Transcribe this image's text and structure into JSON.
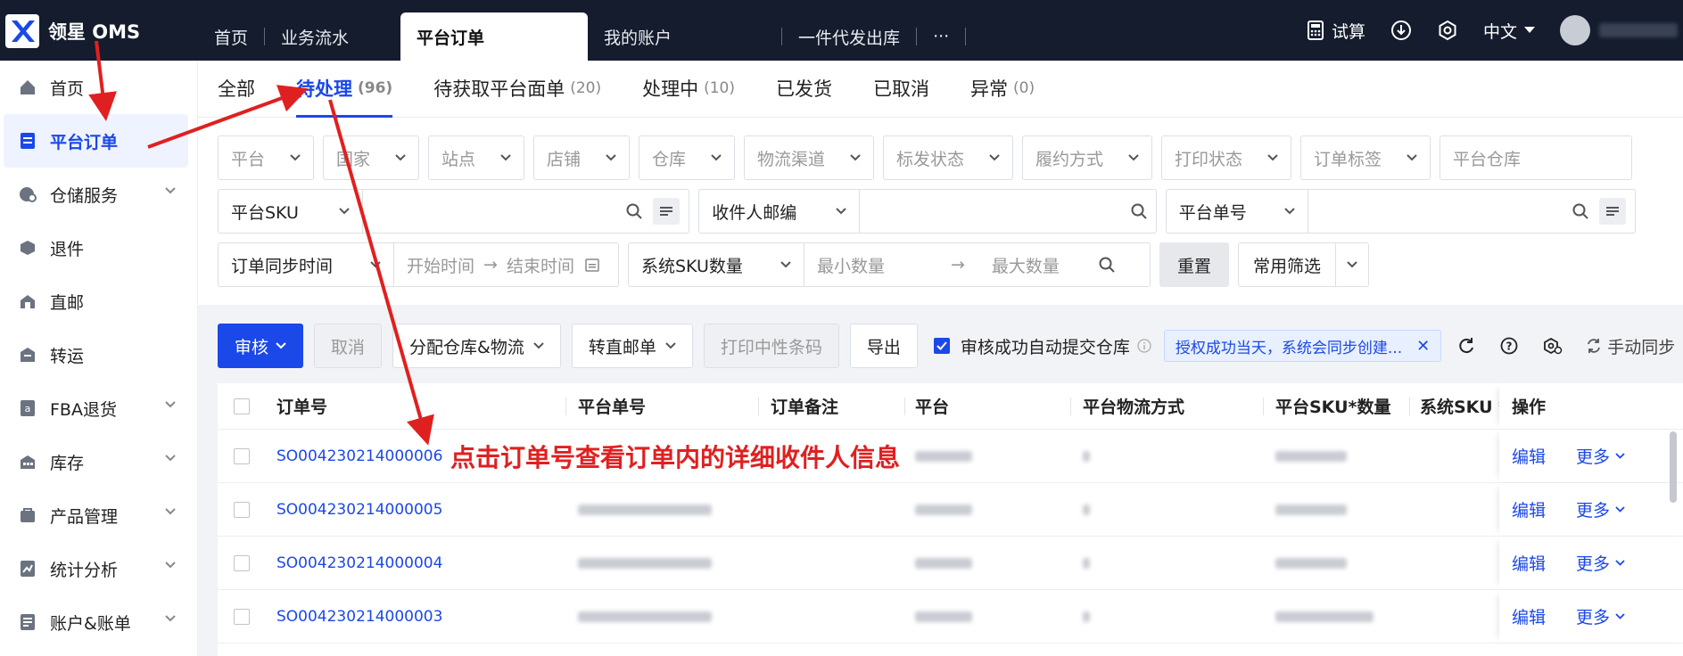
{
  "app": {
    "name": "领星 OMS"
  },
  "topbar": {
    "tabs": [
      "首页",
      "业务流水",
      "平台订单",
      "我的账户",
      "一件代发出库",
      "···"
    ],
    "active_tab_index": 2,
    "right": {
      "calc": "试算",
      "lang": "中文"
    }
  },
  "sidebar": {
    "items": [
      {
        "label": "首页",
        "icon": "home-icon",
        "chevron": false
      },
      {
        "label": "平台订单",
        "icon": "order-icon",
        "chevron": false,
        "active": true
      },
      {
        "label": "仓储服务",
        "icon": "warehouse-icon",
        "chevron": true
      },
      {
        "label": "退件",
        "icon": "return-icon",
        "chevron": false
      },
      {
        "label": "直邮",
        "icon": "direct-mail-icon",
        "chevron": false
      },
      {
        "label": "转运",
        "icon": "transfer-icon",
        "chevron": false
      },
      {
        "label": "FBA退货",
        "icon": "fba-icon",
        "chevron": true
      },
      {
        "label": "库存",
        "icon": "inventory-icon",
        "chevron": true
      },
      {
        "label": "产品管理",
        "icon": "product-icon",
        "chevron": true
      },
      {
        "label": "统计分析",
        "icon": "chart-icon",
        "chevron": true
      },
      {
        "label": "账户&账单",
        "icon": "account-icon",
        "chevron": true
      }
    ]
  },
  "subtabs": [
    {
      "label": "全部",
      "count": ""
    },
    {
      "label": "待处理",
      "count": "(96)",
      "active": true
    },
    {
      "label": "待获取平台面单",
      "count": "(20)"
    },
    {
      "label": "处理中",
      "count": "(10)"
    },
    {
      "label": "已发货",
      "count": ""
    },
    {
      "label": "已取消",
      "count": ""
    },
    {
      "label": "异常",
      "count": "(0)"
    }
  ],
  "filters": {
    "row1": [
      "平台",
      "国家",
      "站点",
      "店铺",
      "仓库",
      "物流渠道",
      "标发状态",
      "履约方式",
      "打印状态",
      "订单标签"
    ],
    "row1_input": "平台仓库",
    "sku_select": "平台SKU",
    "zip_select": "收件人邮编",
    "platform_no_select": "平台单号",
    "sync_time_select": "订单同步时间",
    "start_time": "开始时间",
    "end_time": "结束时间",
    "sku_qty_select": "系统SKU数量",
    "min_qty": "最小数量",
    "max_qty": "最大数量",
    "reset": "重置",
    "common_filter": "常用筛选"
  },
  "actions": {
    "review": "审核",
    "cancel": "取消",
    "assign": "分配仓库&物流",
    "to_direct": "转直邮单",
    "print_neutral": "打印中性条码",
    "export": "导出",
    "auto_submit": "审核成功自动提交仓库",
    "notice": "授权成功当天，系统会同步创建...",
    "manual_sync": "手动同步"
  },
  "table": {
    "headers": [
      "订单号",
      "平台单号",
      "订单备注",
      "平台",
      "平台物流方式",
      "平台SKU*数量",
      "系统SKU *",
      "操作"
    ],
    "rows": [
      {
        "order_no": "SO004230214000006"
      },
      {
        "order_no": "SO004230214000005"
      },
      {
        "order_no": "SO004230214000004"
      },
      {
        "order_no": "SO004230214000003"
      }
    ],
    "edit": "编辑",
    "more": "更多"
  },
  "annotation": "点击订单号查看订单内的详细收件人信息",
  "colors": {
    "accent": "#1b48e8",
    "topbar": "#141c2d",
    "annotation": "#e02020"
  }
}
